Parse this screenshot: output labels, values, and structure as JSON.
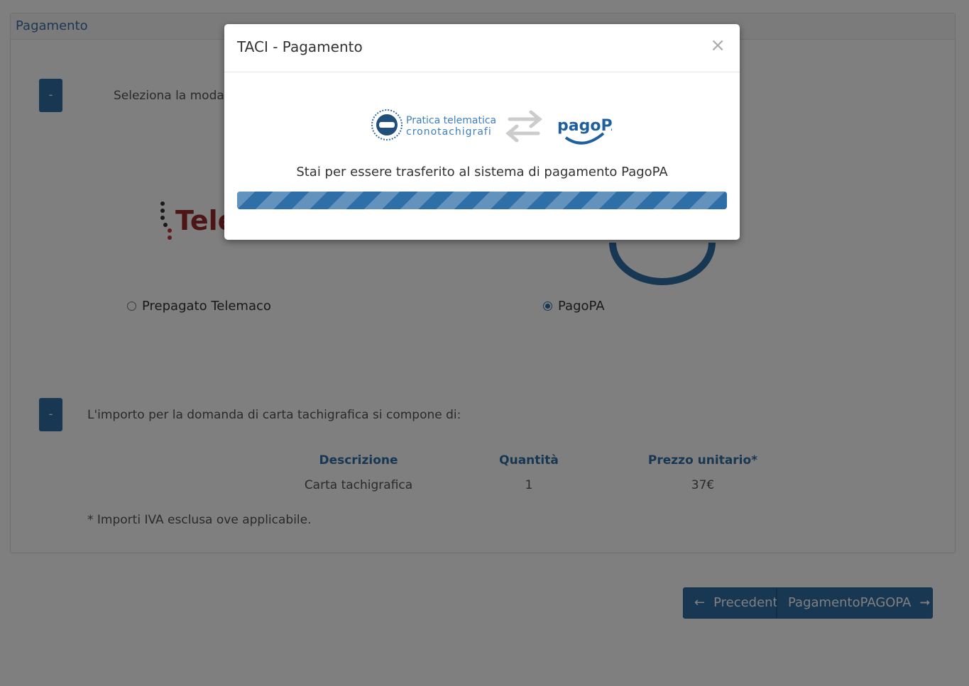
{
  "panel": {
    "heading": "Pagamento",
    "section1": {
      "toggle": "-",
      "text": "Seleziona la moda"
    },
    "tele_logo_text": "Tele",
    "radios": [
      {
        "label": "Prepagato Telemaco",
        "checked": false
      },
      {
        "label": "PagoPA",
        "checked": true
      }
    ],
    "section2": {
      "toggle": "-",
      "text": "L'importo per la domanda di carta tachigrafica si compone di:"
    },
    "table": {
      "headers": [
        "Descrizione",
        "Quantità",
        "Prezzo unitario*"
      ],
      "rows": [
        [
          "Carta tachigrafica",
          "1",
          "37€"
        ]
      ]
    },
    "footnote": "* Importi IVA esclusa ove applicabile."
  },
  "nav": {
    "prev_label": "Precedente",
    "next_label": "PagamentoPAGOPA"
  },
  "modal": {
    "title": "TACI - Pagamento",
    "close_icon": "close-icon",
    "brand_line1": "Pratica telematica",
    "brand_line2": "cronotachigrafi",
    "pagopa_logo": "pagoPA",
    "message": "Stai per essere trasferito al sistema di pagamento PagoPA",
    "progress_value": 1.0
  },
  "colors": {
    "primary": "#2f6fa7",
    "heading": "#3f6fa8"
  }
}
